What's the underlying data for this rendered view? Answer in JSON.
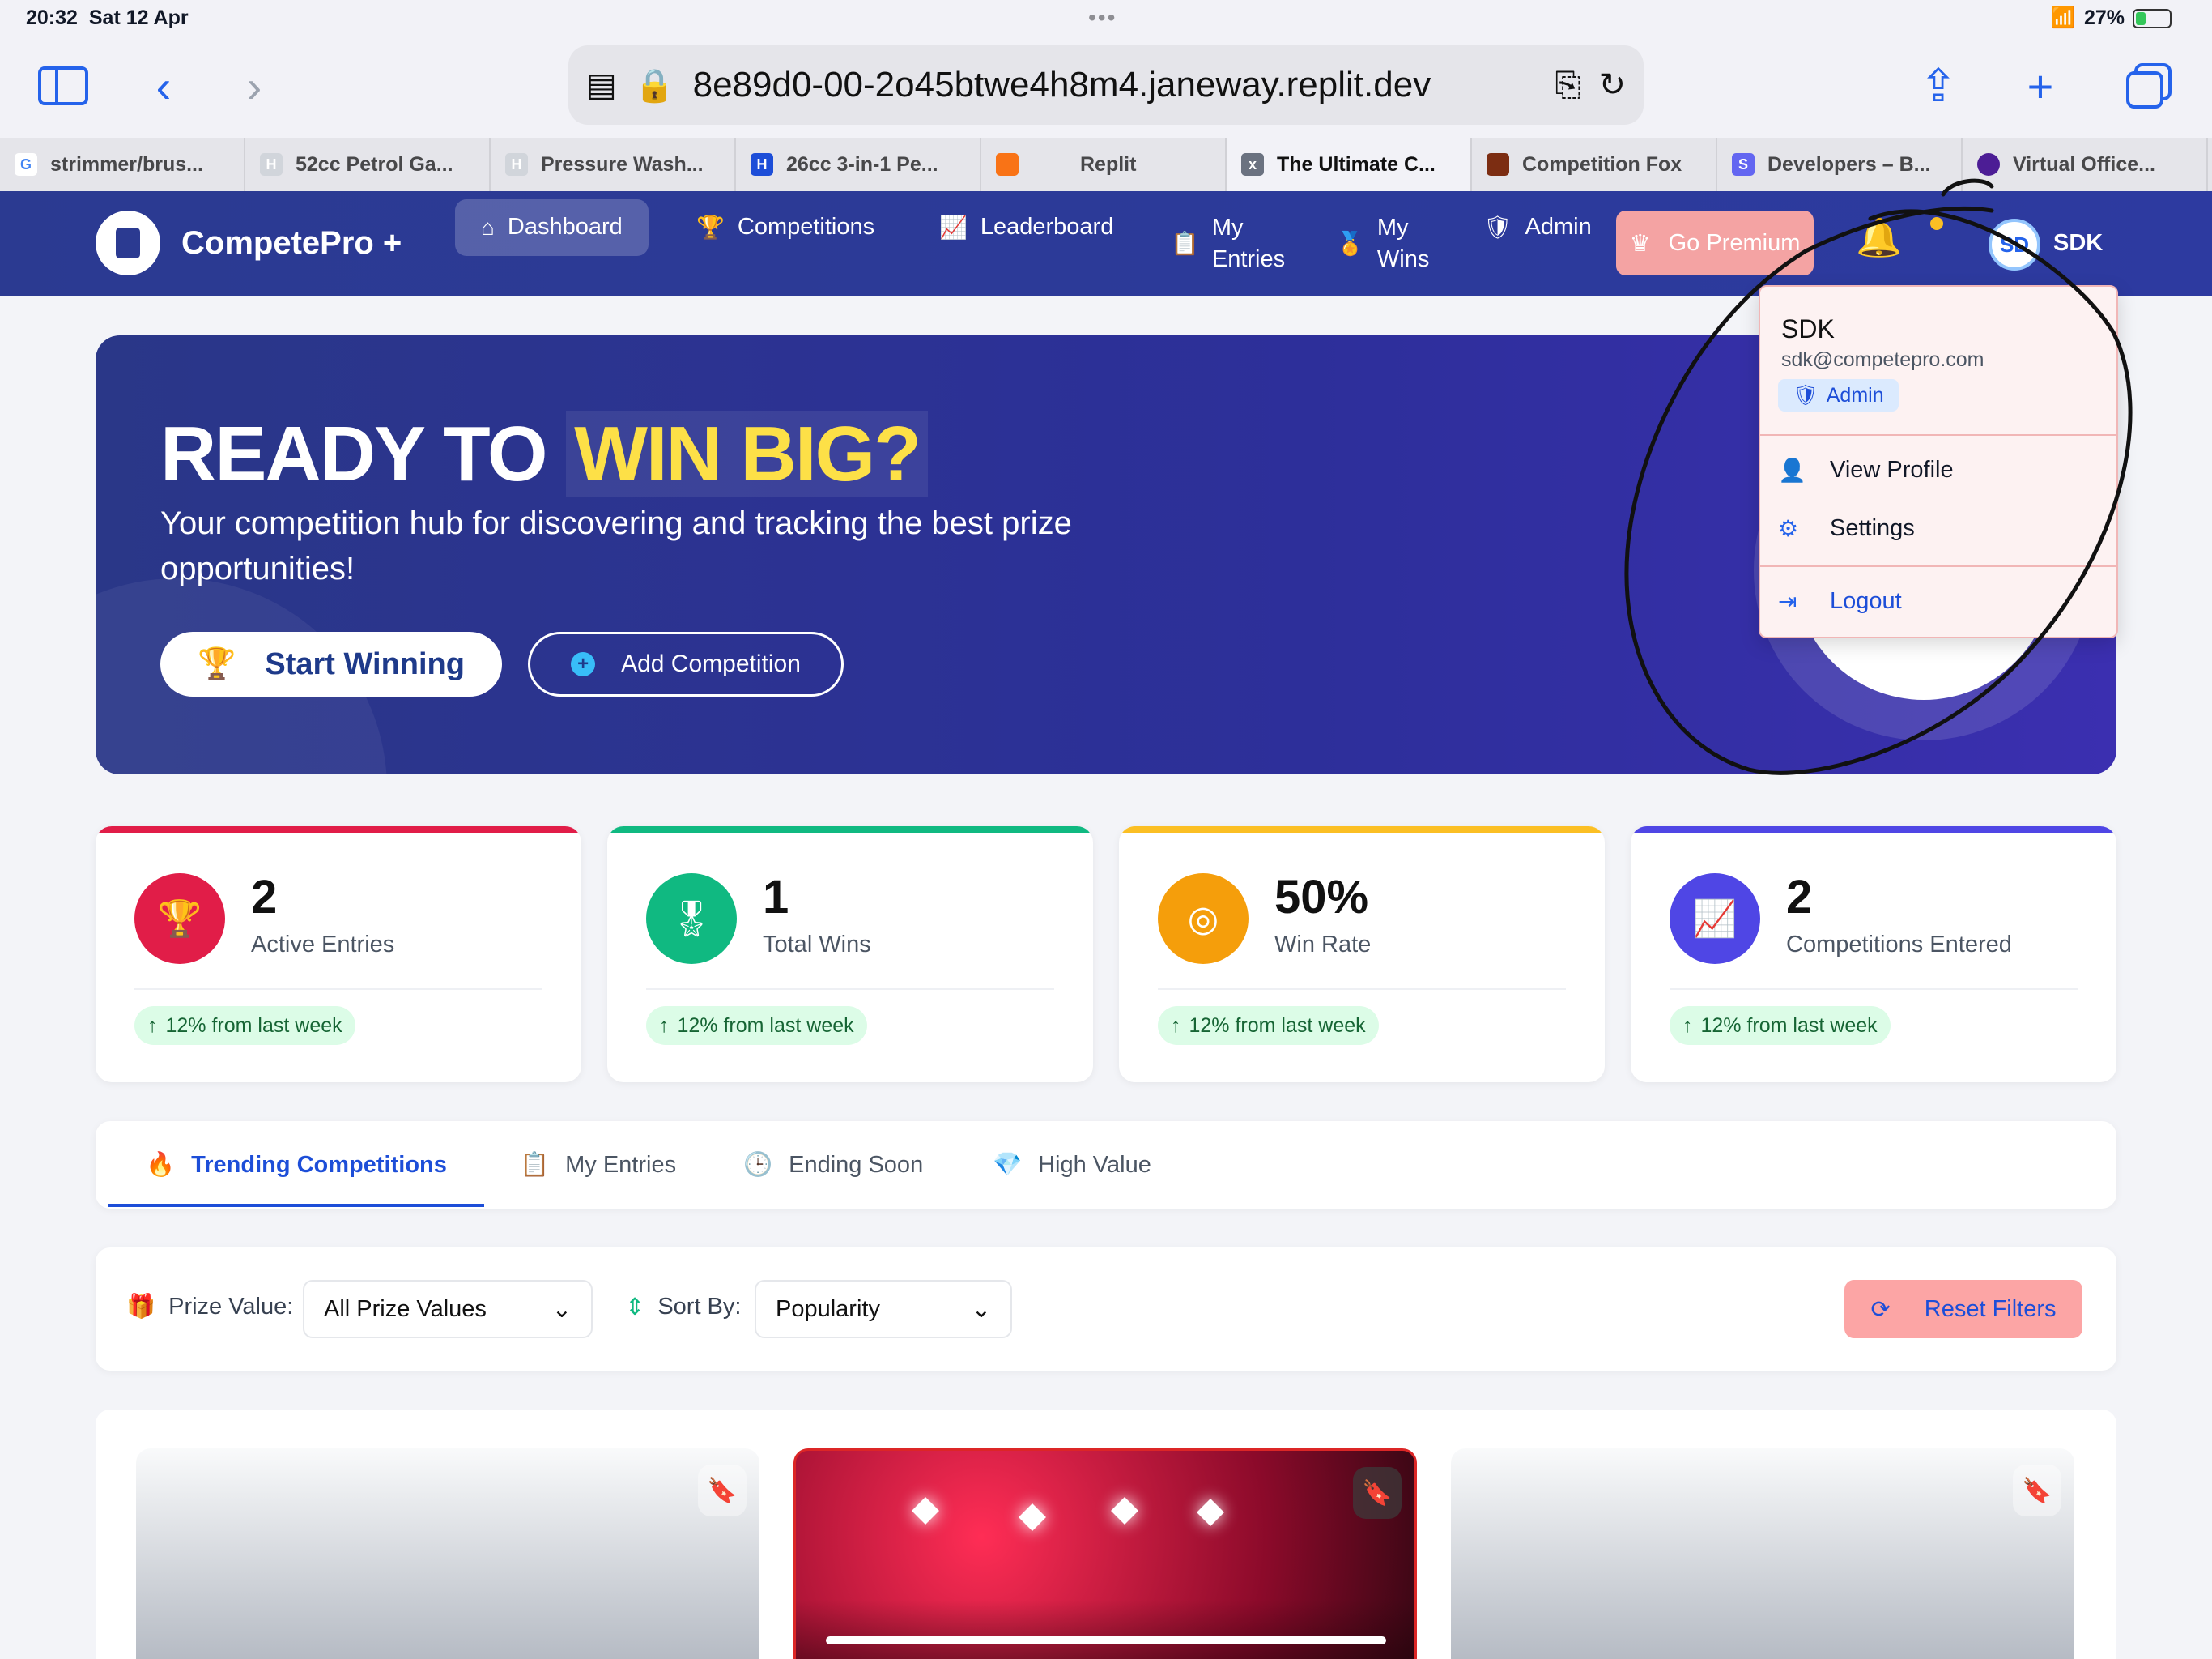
{
  "status_bar": {
    "time": "20:32",
    "date": "Sat 12 Apr",
    "battery": "27%"
  },
  "browser": {
    "url": "8e89d0-00-2o45btwe4h8m4.janeway.replit.dev",
    "tabs": [
      {
        "label": "strimmer/brus...",
        "favicon": "G"
      },
      {
        "label": "52cc Petrol Ga...",
        "favicon": "H"
      },
      {
        "label": "Pressure Wash...",
        "favicon": "H"
      },
      {
        "label": "26cc 3-in-1 Pe...",
        "favicon": "H"
      },
      {
        "label": "Replit",
        "favicon": "R"
      },
      {
        "label": "The Ultimate C...",
        "favicon": "x"
      },
      {
        "label": "Competition Fox",
        "favicon": "F"
      },
      {
        "label": "Developers – B...",
        "favicon": "S"
      },
      {
        "label": "Virtual Office...",
        "favicon": "V"
      }
    ]
  },
  "app": {
    "logo": "CompetePro +",
    "nav": {
      "dashboard": "Dashboard",
      "competitions": "Competitions",
      "leaderboard": "Leaderboard",
      "my_entries_1": "My",
      "my_entries_2": "Entries",
      "my_wins_1": "My",
      "my_wins_2": "Wins",
      "admin": "Admin",
      "premium": "Go Premium"
    },
    "user": {
      "initials": "SD",
      "name": "SDK"
    }
  },
  "hero": {
    "title_plain": "READY TO",
    "title_highlight": "WIN BIG?",
    "subtitle": "Your competition hub for discovering and tracking the best prize opportunities!",
    "start_button": "Start Winning",
    "add_button": "Add Competition"
  },
  "dropdown": {
    "name": "SDK",
    "email": "sdk@competepro.com",
    "role": "Admin",
    "view_profile": "View Profile",
    "settings": "Settings",
    "logout": "Logout"
  },
  "stats": [
    {
      "value": "2",
      "label": "Active Entries",
      "trend": "12% from last week",
      "color": "#e11d48"
    },
    {
      "value": "1",
      "label": "Total Wins",
      "trend": "12% from last week",
      "color": "#10b981"
    },
    {
      "value": "50%",
      "label": "Win Rate",
      "trend": "12% from last week",
      "color": "#f59e0b"
    },
    {
      "value": "2",
      "label": "Competitions Entered",
      "trend": "12% from last week",
      "color": "#4f46e5"
    }
  ],
  "segment_tabs": {
    "trending": "Trending Competitions",
    "my_entries": "My Entries",
    "ending_soon": "Ending Soon",
    "high_value": "High Value"
  },
  "filters": {
    "prize_label": "Prize Value:",
    "prize_value": "All Prize Values",
    "sort_label": "Sort By:",
    "sort_value": "Popularity",
    "reset": "Reset Filters"
  }
}
